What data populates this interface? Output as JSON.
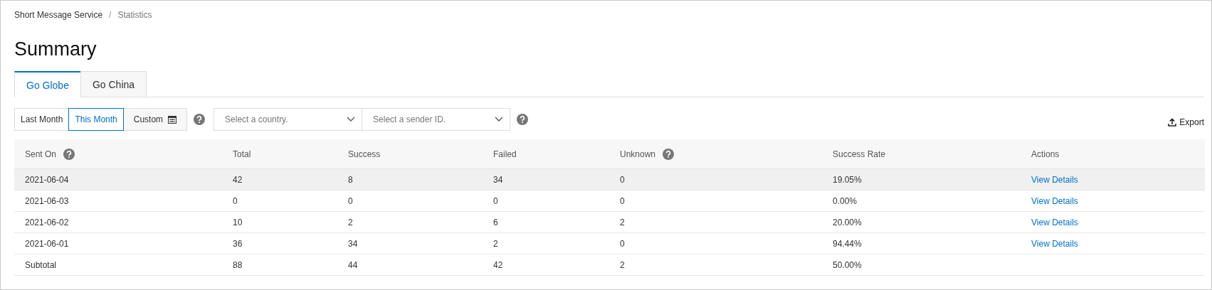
{
  "breadcrumb": [
    "Short Message Service",
    "Statistics"
  ],
  "breadcrumb_separator": "/",
  "title": "Summary",
  "tabs": [
    {
      "label": "Go Globe",
      "selected": true
    },
    {
      "label": "Go China",
      "selected": false
    }
  ],
  "filters": {
    "periods": [
      {
        "label": "Last Month",
        "selected": false,
        "kind": "text"
      },
      {
        "label": "This Month",
        "selected": true,
        "kind": "text"
      },
      {
        "label": "Custom",
        "selected": false,
        "kind": "calendar"
      }
    ],
    "country": {
      "placeholder": "Select a country."
    },
    "sender": {
      "placeholder": "Select a sender ID."
    },
    "export": "Export"
  },
  "table": {
    "columns": [
      {
        "label": "Sent On",
        "help": true
      },
      {
        "label": "Total",
        "help": false
      },
      {
        "label": "Success",
        "help": false
      },
      {
        "label": "Failed",
        "help": false
      },
      {
        "label": "Unknown",
        "help": true
      },
      {
        "label": "Success Rate",
        "help": false
      },
      {
        "label": "Actions",
        "help": false
      }
    ],
    "rows": [
      {
        "cells": [
          "2021-06-04",
          "42",
          "8",
          "34",
          "0",
          "19.05%"
        ],
        "action": "View Details",
        "hovered": true
      },
      {
        "cells": [
          "2021-06-03",
          "0",
          "0",
          "0",
          "0",
          "0.00%"
        ],
        "action": "View Details",
        "hovered": false
      },
      {
        "cells": [
          "2021-06-02",
          "10",
          "2",
          "6",
          "2",
          "20.00%"
        ],
        "action": "View Details",
        "hovered": false
      },
      {
        "cells": [
          "2021-06-01",
          "36",
          "34",
          "2",
          "0",
          "94.44%"
        ],
        "action": "View Details",
        "hovered": false
      },
      {
        "cells": [
          "Subtotal",
          "88",
          "44",
          "42",
          "2",
          "50.00%"
        ],
        "hovered": false
      }
    ]
  }
}
